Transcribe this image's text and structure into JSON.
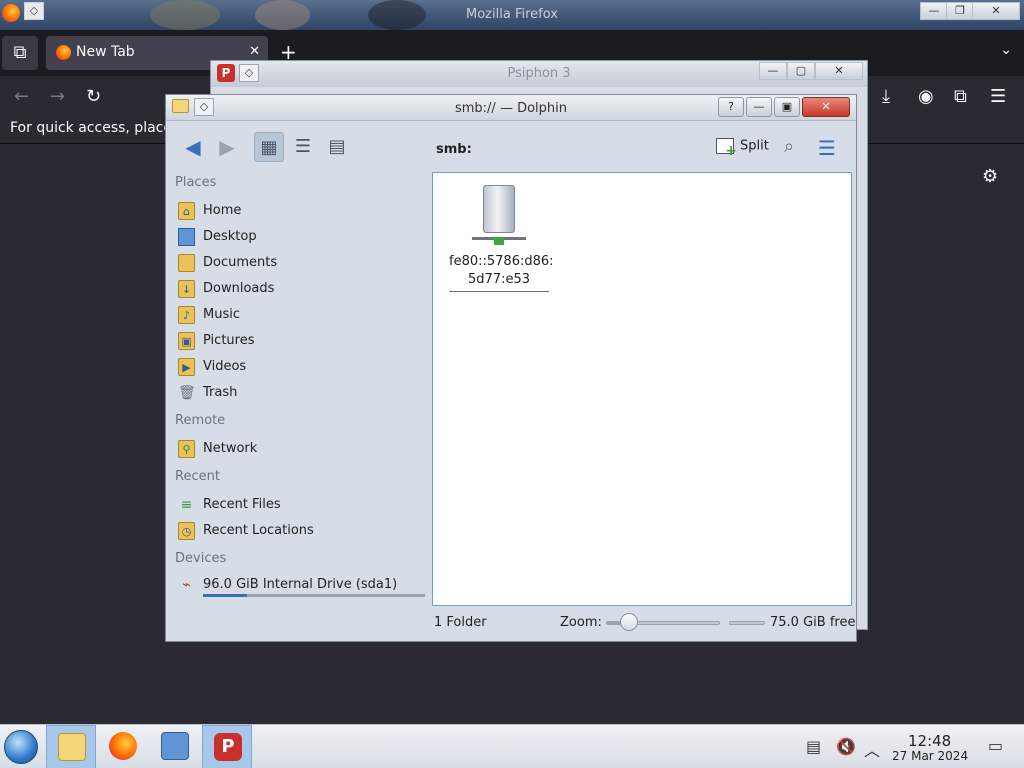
{
  "firefox": {
    "window_title": "Mozilla Firefox",
    "tab_label": "New Tab",
    "tab_close": "✕",
    "new_tab": "+",
    "bookmarks_hint": "For quick access, place",
    "win_min": "—",
    "win_max": "❐",
    "win_close": "✕"
  },
  "psiphon": {
    "title": "Psiphon 3",
    "icon_letter": "P",
    "win_min": "—",
    "win_max": "▢",
    "win_close": "✕"
  },
  "dolphin": {
    "title": "smb:// — Dolphin",
    "help": "?",
    "win_min": "—",
    "win_max": "▣",
    "win_close": "✕",
    "breadcrumb": "smb:",
    "split_label": "Split",
    "places": {
      "sections": [
        {
          "heading": "Places",
          "items": [
            "Home",
            "Desktop",
            "Documents",
            "Downloads",
            "Music",
            "Pictures",
            "Videos",
            "Trash"
          ]
        },
        {
          "heading": "Remote",
          "items": [
            "Network"
          ]
        },
        {
          "heading": "Recent",
          "items": [
            "Recent Files",
            "Recent Locations"
          ]
        },
        {
          "heading": "Devices",
          "items": [
            "96.0 GiB Internal Drive (sda1)"
          ]
        }
      ]
    },
    "items": [
      {
        "label_line1": "fe80::5786:d86:",
        "label_line2": "5d77:e53"
      }
    ],
    "status": {
      "count": "1 Folder",
      "zoom_label": "Zoom:",
      "zoom_level": 0.2,
      "free": "75.0 GiB free",
      "drive_used_fraction": 0.2
    }
  },
  "taskbar": {
    "time": "12:48",
    "date": "27 Mar 2024",
    "psiphon_letter": "P"
  },
  "icons": {
    "back": "back-arrow-icon",
    "forward": "forward-arrow-icon",
    "reload": "reload-icon",
    "search": "search-icon",
    "menu": "hamburger-menu-icon"
  }
}
